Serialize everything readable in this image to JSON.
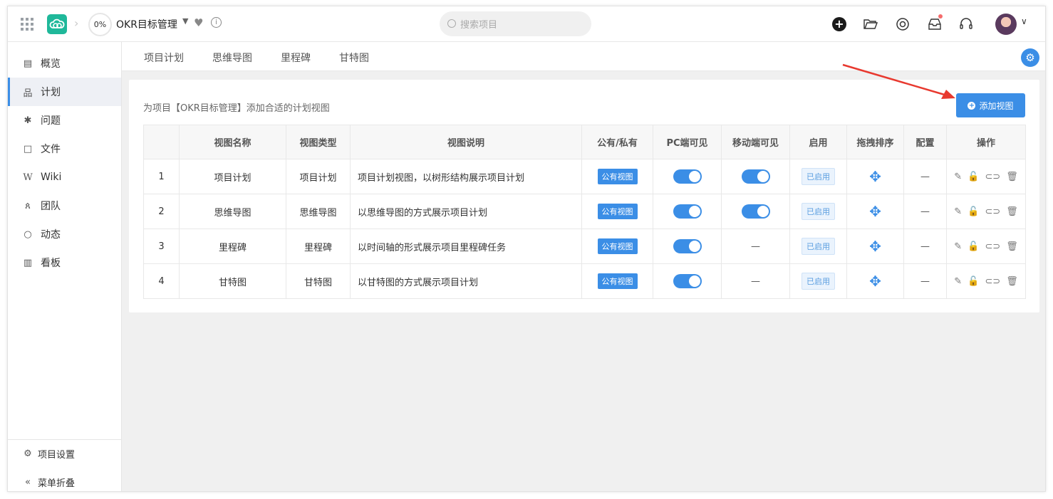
{
  "topbar": {
    "progress": "0%",
    "project_title": "OKR目标管理",
    "search_placeholder": "搜索项目"
  },
  "sidebar": {
    "items": [
      {
        "label": "概览",
        "icon": "list-icon"
      },
      {
        "label": "计划",
        "icon": "hierarchy-icon"
      },
      {
        "label": "问题",
        "icon": "bug-icon"
      },
      {
        "label": "文件",
        "icon": "folder-icon"
      },
      {
        "label": "Wiki",
        "icon": "wiki-icon"
      },
      {
        "label": "团队",
        "icon": "team-icon"
      },
      {
        "label": "动态",
        "icon": "drop-icon"
      },
      {
        "label": "看板",
        "icon": "chart-icon"
      }
    ],
    "settings_label": "项目设置",
    "collapse_label": "菜单折叠"
  },
  "subnav": {
    "tabs": [
      "项目计划",
      "思维导图",
      "里程碑",
      "甘特图"
    ]
  },
  "main": {
    "hint": "为项目【OKR目标管理】添加合适的计划视图",
    "add_view_label": "添加视图",
    "columns": [
      "",
      "视图名称",
      "视图类型",
      "视图说明",
      "公有/私有",
      "PC端可见",
      "移动端可见",
      "启用",
      "拖拽排序",
      "配置",
      "操作"
    ],
    "rows": [
      {
        "index": "1",
        "name": "项目计划",
        "type": "项目计划",
        "desc": "项目计划视图，以树形结构展示项目计划",
        "visibility": "公有视图",
        "pc": true,
        "mobile": true,
        "status": "已启用",
        "config": "—"
      },
      {
        "index": "2",
        "name": "思维导图",
        "type": "思维导图",
        "desc": "以思维导图的方式展示项目计划",
        "visibility": "公有视图",
        "pc": true,
        "mobile": true,
        "status": "已启用",
        "config": "—"
      },
      {
        "index": "3",
        "name": "里程碑",
        "type": "里程碑",
        "desc": "以时间轴的形式展示项目里程碑任务",
        "visibility": "公有视图",
        "pc": true,
        "mobile": false,
        "status": "已启用",
        "config": "—"
      },
      {
        "index": "4",
        "name": "甘特图",
        "type": "甘特图",
        "desc": "以甘特图的方式展示项目计划",
        "visibility": "公有视图",
        "pc": true,
        "mobile": false,
        "status": "已启用",
        "config": "—"
      }
    ],
    "empty_cell": "—"
  },
  "colors": {
    "accent": "#3b8ee6",
    "logo": "#1fb89a",
    "annotation_arrow": "#e8392f"
  }
}
